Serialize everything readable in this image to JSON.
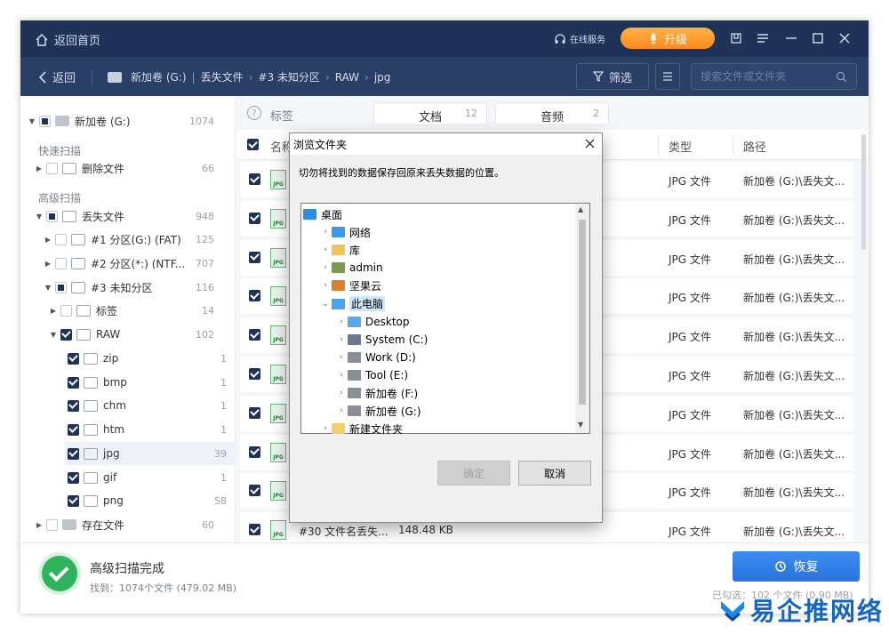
{
  "titlebar": {
    "home_label": "返回首页",
    "service_label": "在线服务",
    "upgrade_label": "升级"
  },
  "nav": {
    "back_label": "返回",
    "crumbs": [
      "新加卷 (G:)",
      "丢失文件",
      "#3 未知分区",
      "RAW",
      "jpg"
    ],
    "filter_label": "筛选",
    "search_placeholder": "搜索文件或文件夹"
  },
  "sidebar": {
    "root": {
      "label": "新加卷 (G:)",
      "count": "1074"
    },
    "quick_scan_label": "快速扫描",
    "deleted": {
      "label": "删除文件",
      "count": "66"
    },
    "advanced_scan_label": "高级扫描",
    "lost": {
      "label": "丢失文件",
      "count": "948"
    },
    "partitions": [
      {
        "label": "#1 分区(G:) (FAT)",
        "count": "125"
      },
      {
        "label": "#2 分区(*:) (NTF...",
        "count": "707"
      },
      {
        "label": "#3 未知分区",
        "count": "116"
      }
    ],
    "tag": {
      "label": "标签",
      "count": "14"
    },
    "raw": {
      "label": "RAW",
      "count": "102"
    },
    "raw_children": [
      {
        "label": "zip",
        "count": "1"
      },
      {
        "label": "bmp",
        "count": "1"
      },
      {
        "label": "chm",
        "count": "1"
      },
      {
        "label": "htm",
        "count": "1"
      },
      {
        "label": "jpg",
        "count": "39"
      },
      {
        "label": "gif",
        "count": "1"
      },
      {
        "label": "png",
        "count": "58"
      }
    ],
    "existing": {
      "label": "存在文件",
      "count": "60"
    }
  },
  "tabs": {
    "tag_label": "标签",
    "doc": {
      "label": "文档",
      "count": "12"
    },
    "audio": {
      "label": "音频",
      "count": "2"
    }
  },
  "table": {
    "col_name": "名称",
    "col_type": "类型",
    "col_path": "路径",
    "row_type": "JPG 文件",
    "row_path": "新加卷 (G:)\\丢失文...",
    "last_row": {
      "name": "#30 文件名丢失...",
      "size": "148.48 KB"
    }
  },
  "footer": {
    "title": "高级扫描完成",
    "subtitle": "找到：1074个文件 (479.02 MB)",
    "recover_label": "恢复",
    "selected_info": "已勾选：102 个文件 (0.90 MB)"
  },
  "dialog": {
    "title": "浏览文件夹",
    "message": "切勿将找到的数据保存回原来丢失数据的位置。",
    "tree": [
      {
        "label": "桌面",
        "level": 0,
        "icon": "desktop"
      },
      {
        "label": "网络",
        "level": 1,
        "icon": "network"
      },
      {
        "label": "库",
        "level": 1,
        "icon": "library"
      },
      {
        "label": "admin",
        "level": 1,
        "icon": "user"
      },
      {
        "label": "坚果云",
        "level": 1,
        "icon": "nut"
      },
      {
        "label": "此电脑",
        "level": 1,
        "icon": "pc"
      },
      {
        "label": "Desktop",
        "level": 2,
        "icon": "folder-blue"
      },
      {
        "label": "System (C:)",
        "level": 2,
        "icon": "drive-win"
      },
      {
        "label": "Work (D:)",
        "level": 2,
        "icon": "drive"
      },
      {
        "label": "Tool (E:)",
        "level": 2,
        "icon": "drive"
      },
      {
        "label": "新加卷 (F:)",
        "level": 2,
        "icon": "drive"
      },
      {
        "label": "新加卷 (G:)",
        "level": 2,
        "icon": "drive"
      },
      {
        "label": "新建文件夹",
        "level": 1,
        "icon": "folder"
      }
    ],
    "ok_label": "确定",
    "cancel_label": "取消"
  },
  "watermark": {
    "text": "易企推网络"
  },
  "colors": {
    "titlebar": "#1f3358",
    "navbar": "#2a3f66",
    "accent": "#2a72dc",
    "upgrade": "#ff8a1a",
    "success": "#2fb35c"
  }
}
